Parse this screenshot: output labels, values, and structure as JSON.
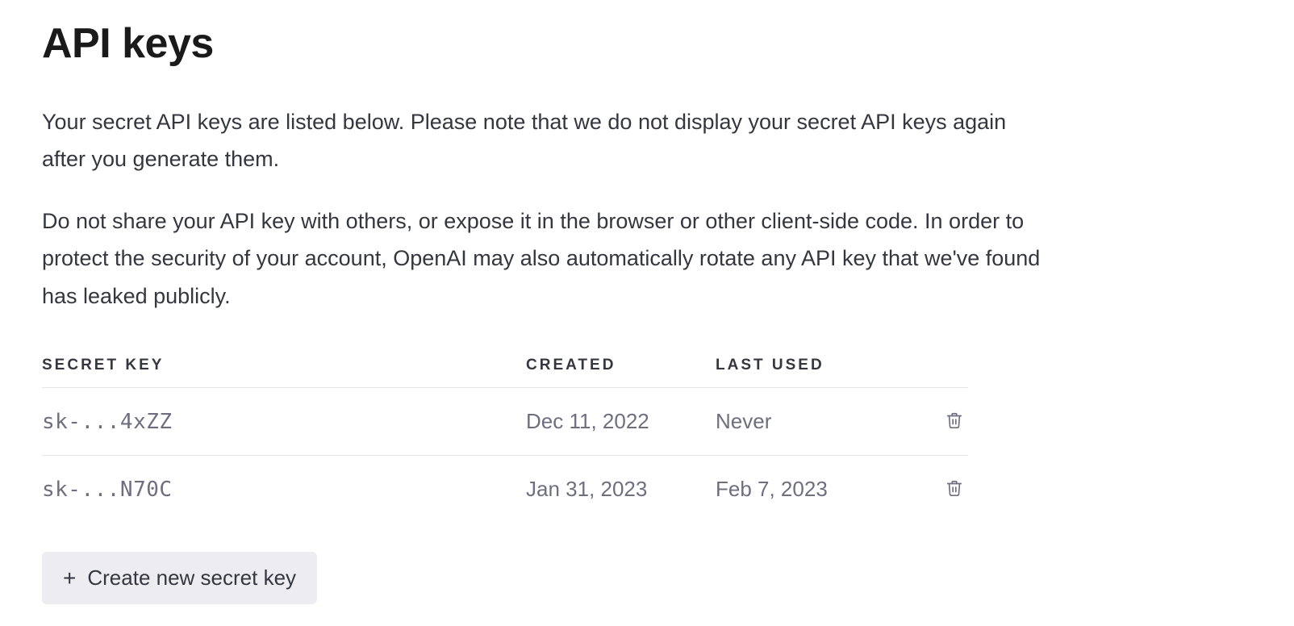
{
  "page": {
    "title": "API keys",
    "paragraph1": "Your secret API keys are listed below. Please note that we do not display your secret API keys again after you generate them.",
    "paragraph2": "Do not share your API key with others, or expose it in the browser or other client-side code. In order to protect the security of your account, OpenAI may also automatically rotate any API key that we've found has leaked publicly."
  },
  "table": {
    "headers": {
      "secret_key": "SECRET KEY",
      "created": "CREATED",
      "last_used": "LAST USED"
    },
    "rows": [
      {
        "secret_key": "sk-...4xZZ",
        "created": "Dec 11, 2022",
        "last_used": "Never"
      },
      {
        "secret_key": "sk-...N70C",
        "created": "Jan 31, 2023",
        "last_used": "Feb 7, 2023"
      }
    ]
  },
  "actions": {
    "create_label": "Create new secret key"
  }
}
